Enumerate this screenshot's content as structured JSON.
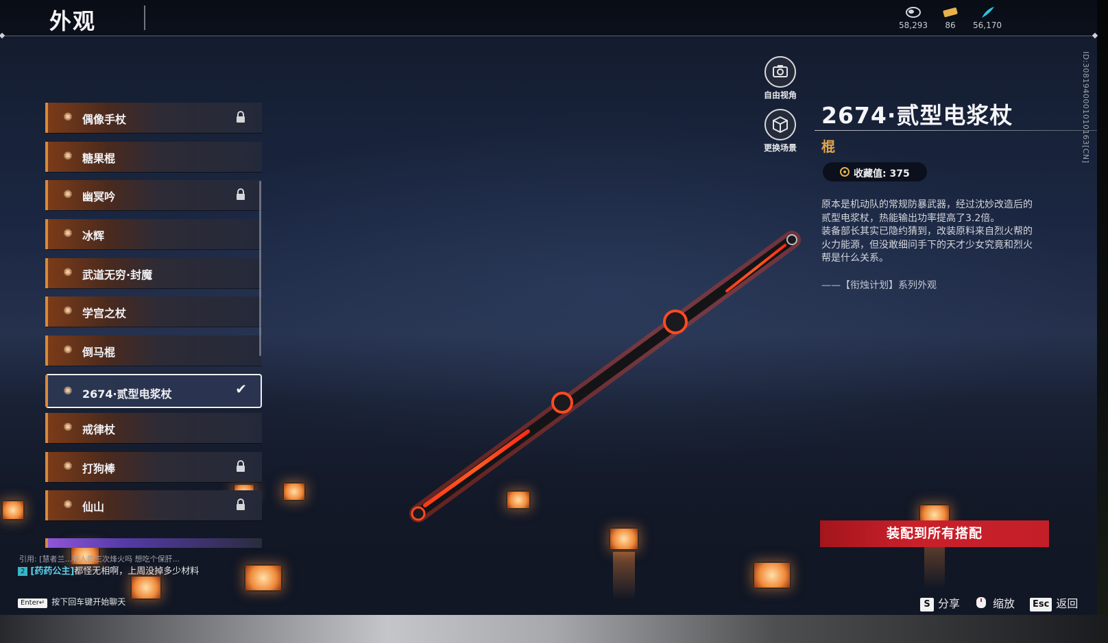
{
  "header": {
    "title": "外观",
    "currencies": [
      {
        "icon": "coin-icon",
        "value": "58,293"
      },
      {
        "icon": "ticket-icon",
        "value": "86"
      },
      {
        "icon": "feather-icon",
        "value": "56,170"
      }
    ]
  },
  "side_id": "ID:3081940001010163[CN]",
  "list": {
    "items": [
      {
        "label": "偶像手杖",
        "locked": true,
        "selected": false
      },
      {
        "label": "糖果棍",
        "locked": false,
        "selected": false
      },
      {
        "label": "幽冥吟",
        "locked": true,
        "selected": false
      },
      {
        "label": "冰辉",
        "locked": false,
        "selected": false
      },
      {
        "label": "武道无穷·封魔",
        "locked": false,
        "selected": false
      },
      {
        "label": "学宫之杖",
        "locked": false,
        "selected": false
      },
      {
        "label": "倒马棍",
        "locked": false,
        "selected": false
      },
      {
        "label": "2674·贰型电浆杖",
        "locked": false,
        "selected": true
      },
      {
        "label": "戒律杖",
        "locked": false,
        "selected": false
      },
      {
        "label": "打狗棒",
        "locked": true,
        "selected": false
      },
      {
        "label": "仙山",
        "locked": true,
        "selected": false
      }
    ]
  },
  "camera": {
    "free_view_label": "自由视角",
    "change_scene_label": "更换场景"
  },
  "detail": {
    "name": "2674·贰型电浆杖",
    "type": "棍",
    "collection_label": "收藏值: 375",
    "description": [
      "原本是机动队的常规防暴武器，经过沈妙改造后的",
      "贰型电浆杖，热能输出功率提高了3.2倍。",
      "装备部长其实已隐约猜到，改装原料来自烈火帮的",
      "火力能源，但没敢细问手下的天才少女究竟和烈火",
      "帮是什么关系。"
    ],
    "series": "——【衔烛计划】系列外观",
    "equip_button": "装配到所有搭配"
  },
  "hotkeys": [
    {
      "key": "S",
      "label": "分享"
    },
    {
      "key": "mouse-icon",
      "label": "缩放"
    },
    {
      "key": "Esc",
      "label": "返回"
    }
  ],
  "chat": {
    "quote": "引用: [慧者兰...有人带三次烽火吗 想吃个保肝...",
    "tag": "2",
    "sender": "[药药公主]",
    "message": "都怪无相啊，上周没掉多少材料",
    "enter_key": "Enter↵",
    "input_hint": "按下回车键开始聊天"
  },
  "colors": {
    "accent_orange": "#d88a3a",
    "type_gold": "#e3a547",
    "equip_red": "#c41f29",
    "chat_cyan": "#5cd0e8"
  }
}
